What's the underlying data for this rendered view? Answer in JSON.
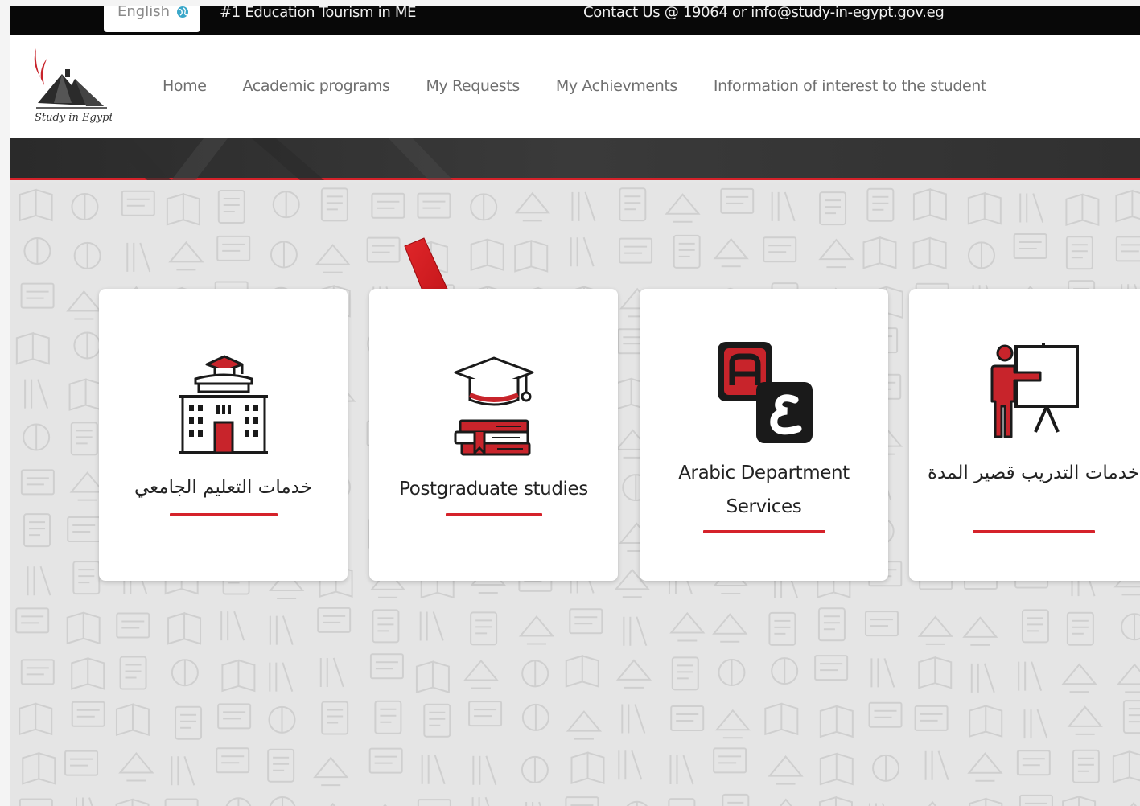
{
  "topbar": {
    "language": "English",
    "tagline": "#1 Education Tourism in ME",
    "contact": "Contact Us @ 19064 or info@study-in-egypt.gov.eg"
  },
  "logo": {
    "text": "Study in Egypt"
  },
  "nav": [
    {
      "label": "Home"
    },
    {
      "label": "Academic programs"
    },
    {
      "label": "My Requests"
    },
    {
      "label": "My Achievments"
    },
    {
      "label": "Information of interest to the student"
    }
  ],
  "cards": [
    {
      "label": "خدمات التعليم الجامعي",
      "icon": "university-building-icon"
    },
    {
      "label": "Postgraduate studies",
      "icon": "graduation-cap-books-icon"
    },
    {
      "label": "Arabic Department Services",
      "icon": "arabic-letters-icon"
    },
    {
      "label": "خدمات التدريب قصير المدة",
      "icon": "trainer-presentation-icon"
    }
  ],
  "colors": {
    "accent": "#d5222a",
    "topbar": "#080808",
    "band": "#333333",
    "nav_text": "#6f6f6f"
  }
}
